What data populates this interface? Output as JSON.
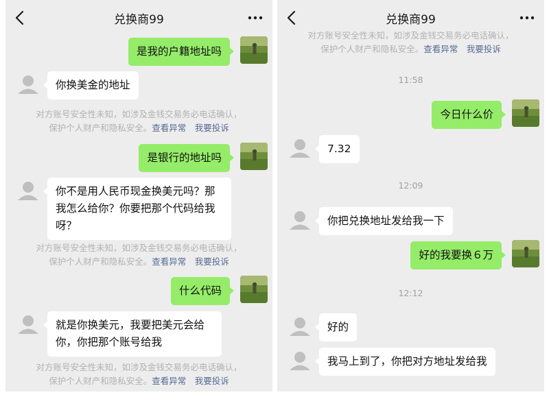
{
  "colors": {
    "background": "#ededed",
    "my_bubble": "#95ec69",
    "other_bubble": "#ffffff",
    "link": "#576b95",
    "notice_text": "#b2b2b2"
  },
  "left": {
    "header": {
      "title": "兑换商99",
      "back_icon": "chevron-left-icon",
      "more_icon": "more-dots-icon"
    },
    "messages": {
      "m1": "是我的户籍地址吗",
      "m2": "你换美金的地址",
      "m3": "是银行的地址吗",
      "m4": [
        "你不是用人民币现金换美元吗？那",
        "我怎么给你？你要把那个代码给我",
        "呀？"
      ],
      "m5": "什么代码",
      "m6": [
        "就是你换美元，我要把美元会给",
        "你，你把那个账号给我"
      ]
    },
    "notice": {
      "line1": "对方账号安全性未知，如涉及金钱交易务必电话确认，",
      "line2_prefix": "保护个人财产和隐私安全。",
      "link_check": "查看异常",
      "link_report": "我要投诉"
    }
  },
  "right": {
    "header": {
      "title": "兑换商99",
      "back_icon": "chevron-left-icon",
      "more_icon": "more-dots-icon"
    },
    "notice": {
      "line1": "对方账号安全性未知，如涉及金钱交易务必电话确认，",
      "line2_prefix": "保护个人财产和隐私安全。",
      "link_check": "查看异常",
      "link_report": "我要投诉"
    },
    "timestamps": {
      "t1": "11:58",
      "t2": "12:09",
      "t3": "12:12"
    },
    "messages": {
      "m1": "今日什么价",
      "m2": "7.32",
      "m3": "你把兑换地址发给我一下",
      "m4": "好的我要换６万",
      "m5": "好的",
      "m6": "我马上到了，你把对方地址发给我"
    }
  }
}
